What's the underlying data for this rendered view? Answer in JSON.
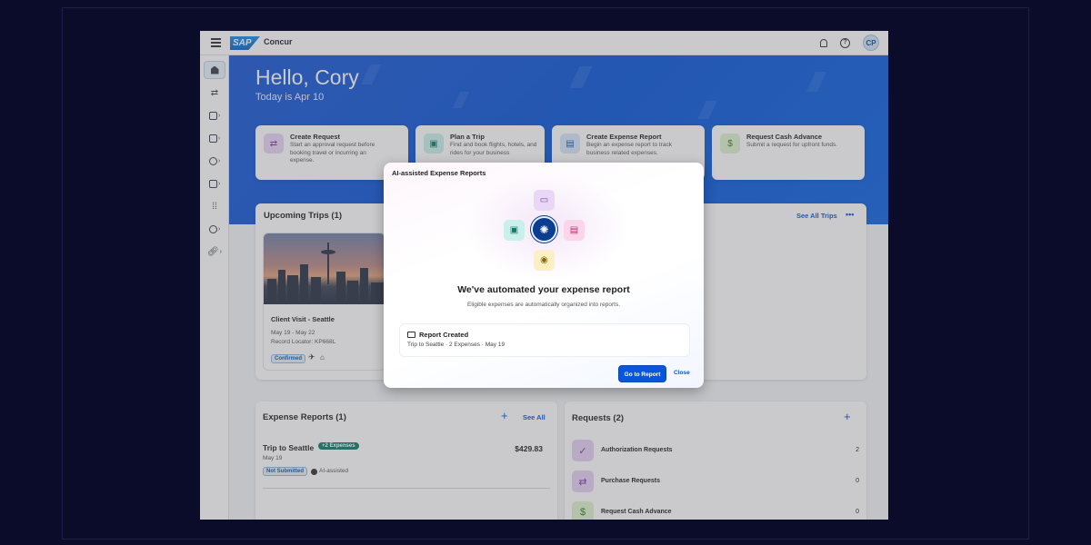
{
  "app": {
    "logo": "SAP",
    "name": "Concur",
    "avatar_initials": "CP"
  },
  "hero": {
    "greeting": "Hello, Cory",
    "today": "Today is Apr 10"
  },
  "quick_actions": [
    {
      "title": "Create Request",
      "desc": "Start an approval request before booking travel or incurring an expense.",
      "icon": "swap-arrows-icon",
      "color": "#e9d5f5"
    },
    {
      "title": "Plan a Trip",
      "desc": "Find and book flights, hotels, and rides for your business",
      "icon": "suitcase-icon",
      "color": "#c9f0ea"
    },
    {
      "title": "Create Expense Report",
      "desc": "Begin an expense report to track business related expenses.",
      "icon": "card-stack-icon",
      "color": "#d6e6fb"
    },
    {
      "title": "Request Cash Advance",
      "desc": "Submit a request for upfront funds.",
      "icon": "money-icon",
      "color": "#dff2cf"
    }
  ],
  "trips": {
    "title": "Upcoming Trips (1)",
    "see_all": "See All Trips",
    "more": "•••",
    "card": {
      "name": "Client Visit - Seattle",
      "dates": "May 19 - May 22",
      "locator": "Record Locator: KP668L",
      "status": "Confirmed"
    }
  },
  "expenses": {
    "title": "Expense Reports (1)",
    "see_all": "See All",
    "plus": "+",
    "item": {
      "name": "Trip to Seattle",
      "badge": "+2 Expenses",
      "amount": "$429.83",
      "date": "May 19",
      "status": "Not Submitted",
      "ai": "AI-assisted"
    }
  },
  "requests": {
    "title": "Requests (2)",
    "plus": "+",
    "items": [
      {
        "label": "Authorization Requests",
        "count": "2",
        "color": "#e6d2f3",
        "glyph": "✓"
      },
      {
        "label": "Purchase Requests",
        "count": "0",
        "color": "#e6d2f3",
        "glyph": "⇄"
      },
      {
        "label": "Request Cash Advance",
        "count": "0",
        "color": "#dff2cf",
        "glyph": "$"
      }
    ]
  },
  "modal": {
    "title": "AI-assisted Expense Reports",
    "heading": "We've automated your expense report",
    "sub": "Eligible expenses are automatically organized into reports.",
    "report_title": "Report Created",
    "report_meta": "Trip to Seattle  ·  2 Expenses  ·  May 19",
    "go_button": "Go to Report",
    "close_button": "Close"
  }
}
